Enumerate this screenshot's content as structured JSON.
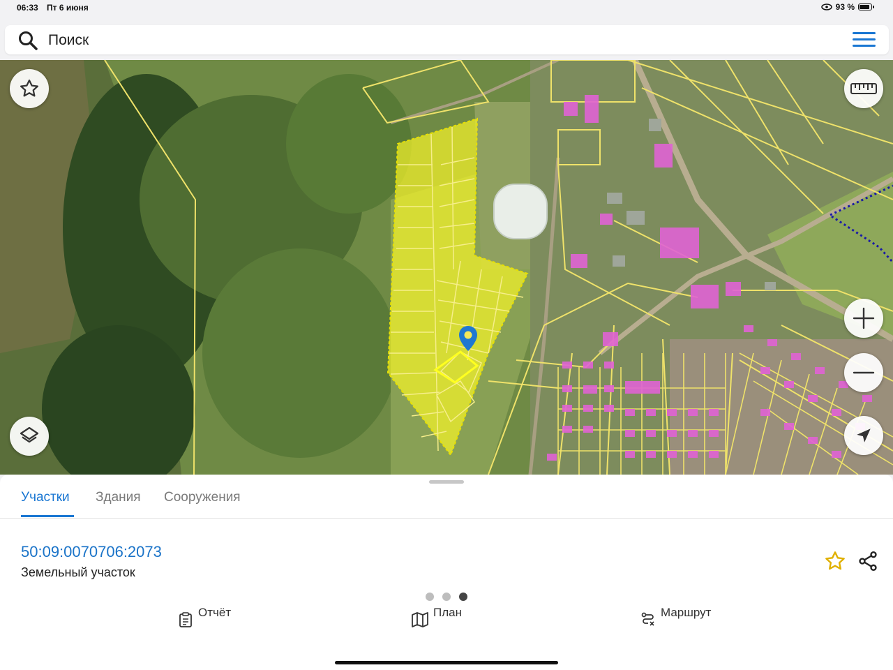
{
  "status_bar": {
    "time": "06:33",
    "date": "Пт 6 июня",
    "battery_text": "93 %",
    "battery_level": 0.93
  },
  "search": {
    "placeholder": "Поиск",
    "icon": "search-icon",
    "menu_icon": "hamburger-menu-icon",
    "accent": "#1976d2"
  },
  "map": {
    "buttons": {
      "favorite": "star-outline-icon",
      "layers": "layers-icon",
      "ruler": "ruler-icon",
      "zoom_in": "plus-icon",
      "zoom_out": "minus-icon",
      "locate": "navigation-arrow-icon"
    },
    "colors": {
      "parcel_outline": "#f0e65a",
      "selected_parcel": "#ffff2a",
      "building": "#e25fd0",
      "boundary": "#1a1aa6",
      "marker": "#1976d2"
    }
  },
  "sheet": {
    "tabs": [
      {
        "label": "Участки",
        "active": true
      },
      {
        "label": "Здания",
        "active": false
      },
      {
        "label": "Сооружения",
        "active": false
      }
    ],
    "cadastral_number": "50:09:0070706:2073",
    "object_type": "Земельный участок",
    "page_dots": {
      "count": 3,
      "active_index": 2
    },
    "favorite_icon_color": "#e0b000"
  },
  "nav": {
    "items": [
      {
        "label": "Отчёт",
        "icon": "report-clipboard-icon"
      },
      {
        "label": "План",
        "icon": "map-plan-icon"
      },
      {
        "label": "Маршрут",
        "icon": "route-icon"
      }
    ]
  }
}
